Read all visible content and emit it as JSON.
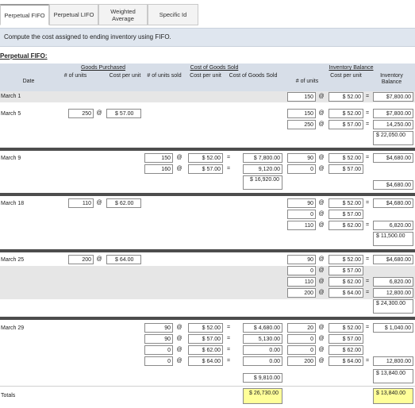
{
  "tabs": [
    "Perpetual FIFO",
    "Perpetual LIFO",
    "Weighted Average",
    "Specific Id"
  ],
  "instruction": "Compute the cost assigned to ending inventory using FIFO.",
  "section_title": "Perpetual FIFO:",
  "headers": {
    "date": "Date",
    "goods_purchased": "Goods Purchased",
    "cogs": "Cost of Goods Sold",
    "inventory_balance": "Inventory Balance",
    "gp_units": "# of units",
    "gp_cost": "Cost per unit",
    "cogs_units": "# of units sold",
    "cogs_cost": "Cost per unit",
    "cogs_total": "Cost of Goods Sold",
    "inv_units": "# of units",
    "inv_cost": "Cost per unit",
    "inv_balance": "Inventory Balance"
  },
  "at": "@",
  "eq": "=",
  "dates": {
    "mar1": "March 1",
    "mar5": "March 5",
    "mar9": "March 9",
    "mar18": "March 18",
    "mar25": "March 25",
    "mar29": "March 29",
    "totals": "Totals"
  },
  "mar1": {
    "inv_units": "150",
    "inv_cost": "$ 52.00",
    "inv_bal": "$7,800.00"
  },
  "mar5": {
    "gp_units": "250",
    "gp_cost": "$ 57.00",
    "inv": [
      {
        "units": "150",
        "cost": "$ 52.00",
        "bal": "$7,800.00"
      },
      {
        "units": "250",
        "cost": "$ 57.00",
        "bal": "14,250.00"
      }
    ],
    "inv_total": "$ 22,050.00"
  },
  "mar9": {
    "cogs": [
      {
        "units": "150",
        "cost": "$ 52.00",
        "total": "$ 7,800.00"
      },
      {
        "units": "160",
        "cost": "$ 57.00",
        "total": "9,120.00"
      }
    ],
    "cogs_total": "$ 16,920.00",
    "inv": [
      {
        "units": "90",
        "cost": "$ 52.00",
        "bal": "$4,680.00"
      },
      {
        "units": "0",
        "cost": "$ 57.00"
      }
    ],
    "inv_total": "$4,680.00"
  },
  "mar18": {
    "gp_units": "110",
    "gp_cost": "$ 62.00",
    "inv": [
      {
        "units": "90",
        "cost": "$ 52.00",
        "bal": "$4,680.00"
      },
      {
        "units": "0",
        "cost": "$ 57.00"
      },
      {
        "units": "110",
        "cost": "$ 62.00",
        "bal": "6,820.00"
      }
    ],
    "inv_total": "$ 11,500.00"
  },
  "mar25": {
    "gp_units": "200",
    "gp_cost": "$ 64.00",
    "inv": [
      {
        "units": "90",
        "cost": "$ 52.00",
        "bal": "$4,680.00"
      },
      {
        "units": "0",
        "cost": "$ 57.00"
      },
      {
        "units": "110",
        "cost": "$ 62.00",
        "bal": "6,820.00"
      },
      {
        "units": "200",
        "cost": "$ 64.00",
        "bal": "12,800.00"
      }
    ],
    "inv_total": "$ 24,300.00"
  },
  "mar29": {
    "cogs": [
      {
        "units": "90",
        "cost": "$ 52.00",
        "total": "$ 4,680.00"
      },
      {
        "units": "90",
        "cost": "$ 57.00",
        "total": "5,130.00"
      },
      {
        "units": "0",
        "cost": "$ 62.00",
        "total": "0.00"
      },
      {
        "units": "0",
        "cost": "$ 64.00",
        "total": "0.00"
      }
    ],
    "cogs_total": "$ 9,810.00",
    "inv": [
      {
        "units": "20",
        "cost": "$ 52.00",
        "bal": "$ 1,040.00"
      },
      {
        "units": "0",
        "cost": "$ 57.00"
      },
      {
        "units": "0",
        "cost": "$ 62.00"
      },
      {
        "units": "200",
        "cost": "$ 64.00",
        "bal": "12,800.00"
      }
    ],
    "inv_total": "$ 13,840.00"
  },
  "totals": {
    "cogs": "$ 26,730.00",
    "inv": "$ 13,840.00"
  }
}
